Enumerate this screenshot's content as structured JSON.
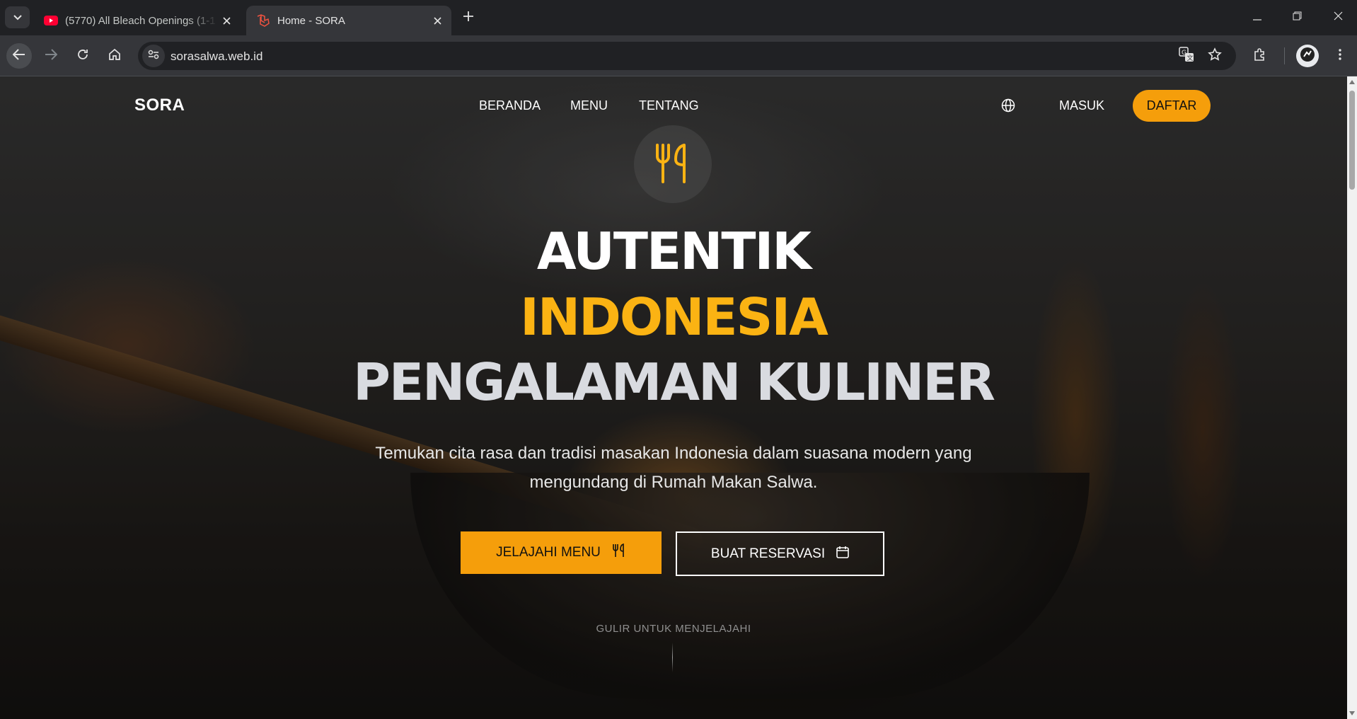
{
  "browser": {
    "tabs": [
      {
        "title": "(5770) All Bleach Openings (1-1",
        "favicon": "youtube-icon",
        "active": false
      },
      {
        "title": "Home - SORA",
        "favicon": "laravel-icon",
        "active": true
      }
    ],
    "url": "sorasalwa.web.id"
  },
  "nav": {
    "logo": "SORA",
    "links": [
      "BERANDA",
      "MENU",
      "TENTANG"
    ],
    "login": "MASUK",
    "register": "DAFTAR"
  },
  "hero": {
    "line1": "AUTENTIK",
    "line2": "INDONESIA",
    "line3": "PENGALAMAN KULINER",
    "subtitle": "Temukan cita rasa dan tradisi masakan Indonesia dalam suasana modern yang mengundang di Rumah Makan Salwa.",
    "explore_button": "JELAJAHI MENU",
    "reserve_button": "BUAT RESERVASI",
    "scroll_hint": "GULIR UNTUK MENJELAJAHI"
  },
  "colors": {
    "accent": "#f59e0b",
    "headline_accent": "#fbb313"
  }
}
